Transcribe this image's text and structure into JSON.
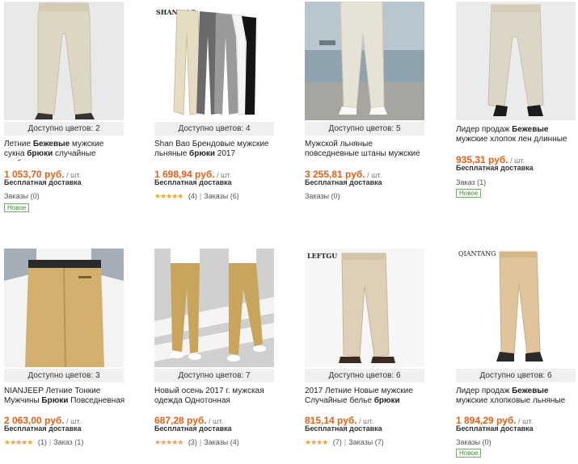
{
  "products": [
    {
      "colors": "Доступно цветов: 2",
      "title_pre": "Летние ",
      "title_bold": "Бежевые",
      "title_mid": " мужские сукна ",
      "title_bold2": "брюки",
      "title_post": " случайные свободные",
      "price": "1 053,70 руб.",
      "unit": " / шт.",
      "shipping": "Бесплатная доставка",
      "stars": "",
      "reviews": "",
      "orders": "Заказы (0)",
      "badge": "Новое"
    },
    {
      "colors": "Доступно цветов: 4",
      "brand": "SHAN BAO",
      "title_pre": "Shan Bao Брендовые мужские льняные ",
      "title_bold": "брюки",
      "title_mid": " 2017",
      "title_bold2": "",
      "title_post": "",
      "price": "1 698,94 руб.",
      "unit": " / шт.",
      "shipping": "Бесплатная доставка",
      "stars": "★★★★★",
      "reviews": "(4)",
      "orders": "Заказы (6)",
      "badge": ""
    },
    {
      "colors": "Доступно цветов: 5",
      "title_pre": "Мужской льняные повседневные штаны мужские летние дышащие",
      "title_bold": "",
      "title_mid": "",
      "title_bold2": "",
      "title_post": "",
      "price": "3 255,81 руб.",
      "unit": " / шт.",
      "shipping": "Бесплатная доставка",
      "stars": "",
      "reviews": "",
      "orders": "Заказы (0)",
      "badge": ""
    },
    {
      "colors": "",
      "title_pre": "Лидер продаж ",
      "title_bold": "Бежевые",
      "title_mid": " мужские хлопок лен длинные",
      "title_bold2": "",
      "title_post": "",
      "price": "935,31 руб.",
      "unit": " / шт.",
      "shipping": "Бесплатная доставка",
      "stars": "",
      "reviews": "",
      "orders": "Заказ (1)",
      "badge": "Новое"
    },
    {
      "colors": "Доступно цветов: 3",
      "title_pre": "NIANJEEP Летние Тонкие Мужчины ",
      "title_bold": "Брюки",
      "title_mid": " Повседневная",
      "title_bold2": "",
      "title_post": "",
      "price": "2 063,00 руб.",
      "unit": " / шт.",
      "shipping": "Бесплатная доставка",
      "stars": "★★★★★",
      "reviews": "(1)",
      "orders": "Заказ (1)",
      "badge": ""
    },
    {
      "colors": "Доступно цветов: 7",
      "title_pre": "Новый осень 2017 г. мужская одежда Однотонная",
      "title_bold": "",
      "title_mid": "",
      "title_bold2": "",
      "title_post": "",
      "price": "687,28 руб.",
      "unit": " / шт.",
      "shipping": "Бесплатная доставка",
      "stars": "★★★★★",
      "reviews": "(3)",
      "orders": "Заказы (4)",
      "badge": ""
    },
    {
      "colors": "Доступно цветов: 6",
      "brand": "LEFTGU",
      "title_pre": "2017 Летние Новые мужские Случайные белье ",
      "title_bold": "брюки",
      "title_mid": "",
      "title_bold2": "",
      "title_post": "",
      "price": "815,14 руб.",
      "unit": " / шт.",
      "shipping": "Бесплатная доставка",
      "stars": "★★★★",
      "reviews": "(7)",
      "orders": "Заказы (7)",
      "badge": ""
    },
    {
      "colors": "Доступно цветов: 6",
      "brand": "QIANTANG",
      "title_pre": "Лидер продаж ",
      "title_bold": "Бежевые",
      "title_mid": " мужские хлопковые льняные",
      "title_bold2": "",
      "title_post": "",
      "price": "1 894,29 руб.",
      "unit": " / шт.",
      "shipping": "Бесплатная доставка",
      "stars": "",
      "reviews": "",
      "orders": "Заказы (0)",
      "badge": "Новое"
    }
  ]
}
